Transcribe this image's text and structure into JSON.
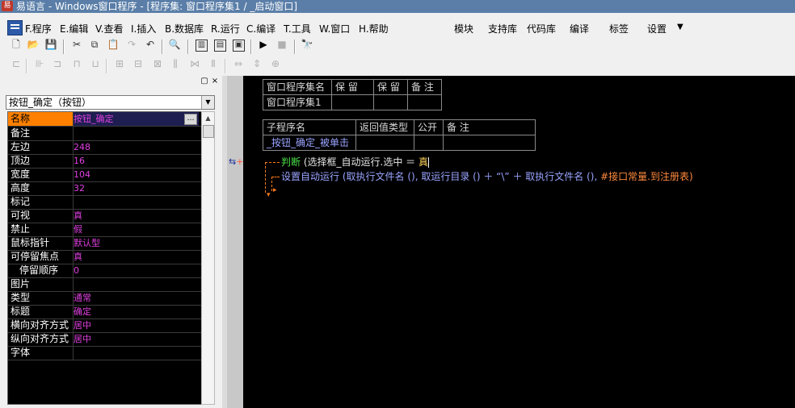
{
  "window": {
    "title": "易语言 - Windows窗口程序 - [程序集: 窗口程序集1 / _启动窗口]"
  },
  "menu": {
    "items": [
      "F.程序",
      "E.编辑",
      "V.查看",
      "I.插入",
      "B.数据库",
      "R.运行",
      "C.编译",
      "T.工具",
      "W.窗口",
      "H.帮助"
    ],
    "right_items": [
      "模块",
      "支持库",
      "代码库",
      "编译",
      "标签",
      "设置"
    ]
  },
  "toolbar": {
    "row1_icons": [
      "new-file",
      "open-file",
      "save-file",
      "cut",
      "copy",
      "paste",
      "redo",
      "undo",
      "find",
      "layout-1",
      "layout-2",
      "layout-3",
      "run",
      "stop",
      "binoculars"
    ],
    "row2_icons": [
      "align-left",
      "align-hcenter",
      "align-right",
      "align-top",
      "align-vcenter",
      "align-bottom",
      "space-h",
      "space-v",
      "same-width",
      "same-height",
      "same-size",
      "center-h",
      "center-v",
      "center-both"
    ]
  },
  "left_panel": {
    "pin_glyph": "▢",
    "close_glyph": "×",
    "object_selector": "按钮_确定（按钮）",
    "properties": [
      {
        "name": "名称",
        "value": "按钮_确定"
      },
      {
        "name": "备注",
        "value": ""
      },
      {
        "name": "左边",
        "value": "248"
      },
      {
        "name": "顶边",
        "value": "16"
      },
      {
        "name": "宽度",
        "value": "104"
      },
      {
        "name": "高度",
        "value": "32"
      },
      {
        "name": "标记",
        "value": ""
      },
      {
        "name": "可视",
        "value": "真"
      },
      {
        "name": "禁止",
        "value": "假"
      },
      {
        "name": "鼠标指针",
        "value": "默认型"
      },
      {
        "name": "可停留焦点",
        "value": "真"
      },
      {
        "name": "停留顺序",
        "value": "0"
      },
      {
        "name": "图片",
        "value": ""
      },
      {
        "name": "类型",
        "value": "通常"
      },
      {
        "name": "标题",
        "value": "确定"
      },
      {
        "name": "横向对齐方式",
        "value": "居中"
      },
      {
        "name": "纵向对齐方式",
        "value": "居中"
      },
      {
        "name": "字体",
        "value": ""
      }
    ]
  },
  "editor": {
    "assembly_table": {
      "headers": [
        "窗口程序集名",
        "保 留",
        "保 留",
        "备 注"
      ],
      "row": [
        "窗口程序集1",
        "",
        "",
        ""
      ]
    },
    "sub_table": {
      "headers": [
        "子程序名",
        "返回值类型",
        "公开",
        "备 注"
      ],
      "row": [
        "_按钮_确定_被单击",
        "",
        "",
        ""
      ]
    },
    "code": {
      "line1": {
        "keyword": "判断",
        "expr": "(选择框_自动运行.选中 ＝ ",
        "value": "真"
      },
      "line2": {
        "keyword": "设置自动运行",
        "p1": "(取执行文件名 (),",
        "p2": "取运行目录 () ＋ “\\” ＋ 取执行文件名 (),",
        "p3": "#接口常量.到注册表)"
      }
    },
    "gutter_marks": {
      "left": "⇆",
      "plus": "+"
    }
  }
}
